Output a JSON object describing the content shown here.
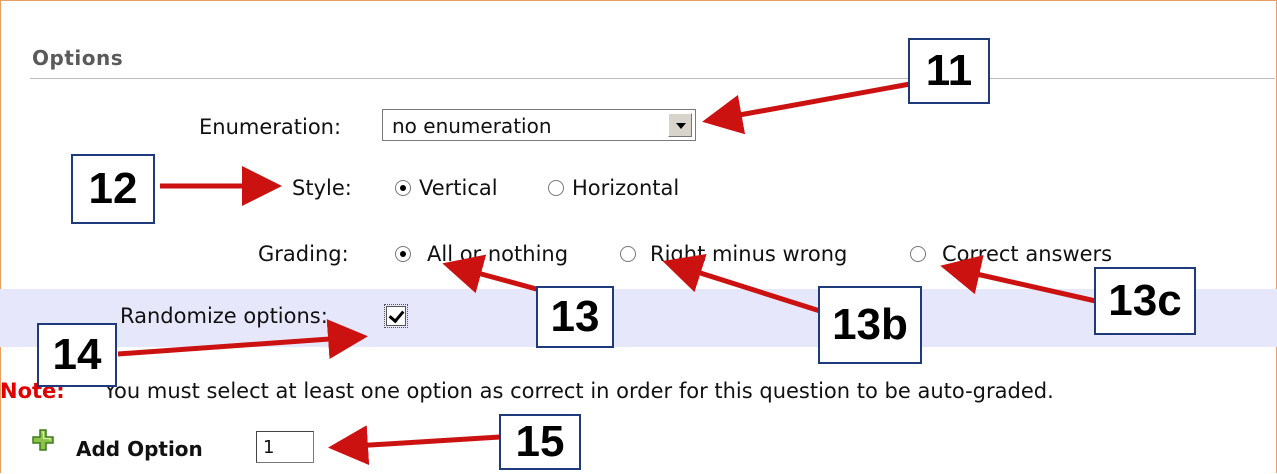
{
  "section": {
    "title": "Options"
  },
  "enumeration": {
    "label": "Enumeration:",
    "value": "no enumeration"
  },
  "style": {
    "label": "Style:",
    "options": [
      {
        "label": "Vertical",
        "checked": true
      },
      {
        "label": "Horizontal",
        "checked": false
      }
    ]
  },
  "grading": {
    "label": "Grading:",
    "options": [
      {
        "label": "All or nothing",
        "checked": true
      },
      {
        "label": "Right minus wrong",
        "checked": false
      },
      {
        "label": "Correct answers",
        "checked": false
      }
    ]
  },
  "randomize": {
    "label": "Randomize options:",
    "checked": true
  },
  "note": {
    "label": "Note:",
    "text": "You must select at least one option as correct in order for this question to be auto-graded."
  },
  "add_option": {
    "label": "Add Option",
    "quantity": "1",
    "icon": "plus-icon"
  },
  "callouts": [
    "11",
    "12",
    "13",
    "13b",
    "13c",
    "14",
    "15"
  ],
  "colors": {
    "arrow": "#cc1111",
    "callout_border": "#1f3a7a",
    "note": "#e00000",
    "band": "#e7e7fb",
    "frame": "#e8a060"
  }
}
